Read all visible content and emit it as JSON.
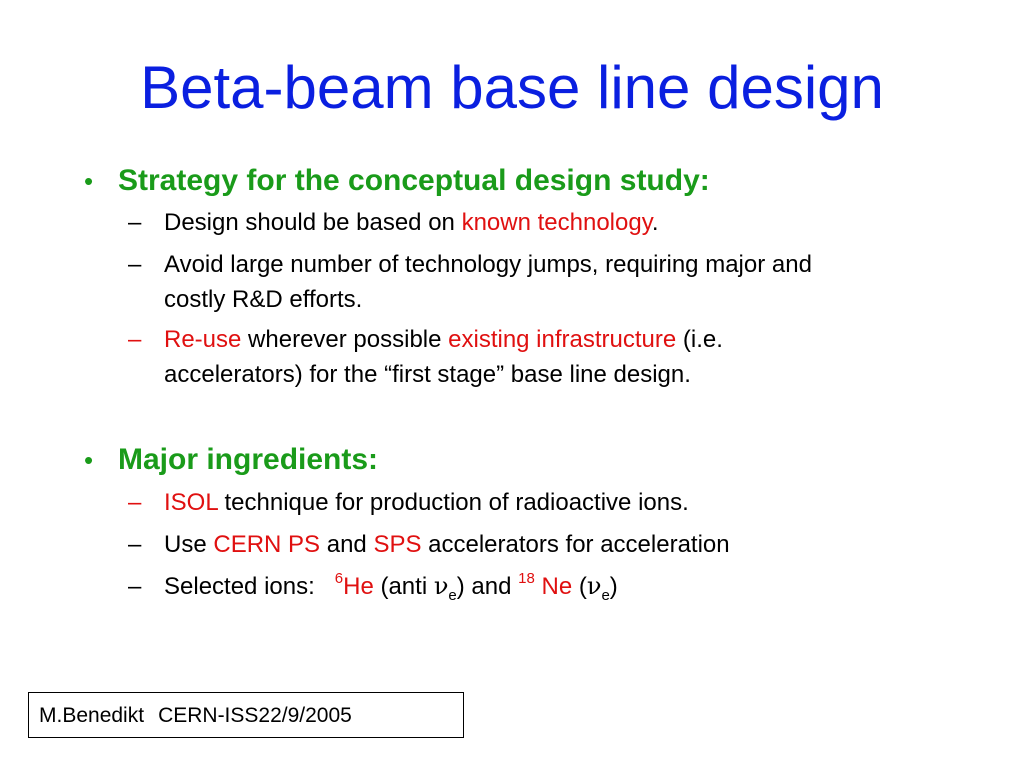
{
  "slide": {
    "title": "Beta-beam base line design",
    "sections": [
      {
        "bullet": "•",
        "heading": "Strategy for the conceptual design study:",
        "items": [
          {
            "dash": "–",
            "text_before": "Design should be based on ",
            "red": "known technology",
            "text_after": "."
          },
          {
            "dash": "–",
            "line1": "Avoid large number of technology jumps, requiring major and",
            "line2": "costly R&D efforts."
          },
          {
            "dash": "–",
            "red1": "Re-use",
            "middle": " wherever possible ",
            "red2": "existing infrastructure",
            "after": " (i.e.",
            "line2": "accelerators) for the “first stage” base line design."
          }
        ]
      },
      {
        "bullet": "•",
        "heading": "Major ingredients:",
        "items": [
          {
            "dash": "–",
            "red": "ISOL",
            "after": " technique for production of radioactive ions."
          },
          {
            "dash": "–",
            "before": "Use ",
            "red1": "CERN PS",
            "middle": " and ",
            "red2": "SPS",
            "after": " accelerators for acceleration"
          },
          {
            "dash": "–",
            "before": "Selected ions:   ",
            "sup1": "6",
            "red1": "He",
            "mid1": " (anti ",
            "nu1": "ν",
            "sub1": "e",
            "mid2": ") and ",
            "sup2": "18",
            "red2": " Ne",
            "mid3": " (",
            "nu2": "ν",
            "sub2": "e",
            "end": ")"
          }
        ]
      }
    ],
    "footer": {
      "author": "M.Benedikt",
      "ref": "CERN-ISS22/9/2005"
    }
  },
  "colors": {
    "title": "#0a1fe0",
    "heading": "#1a9b1a",
    "highlight": "#e01010",
    "text": "#000000"
  }
}
